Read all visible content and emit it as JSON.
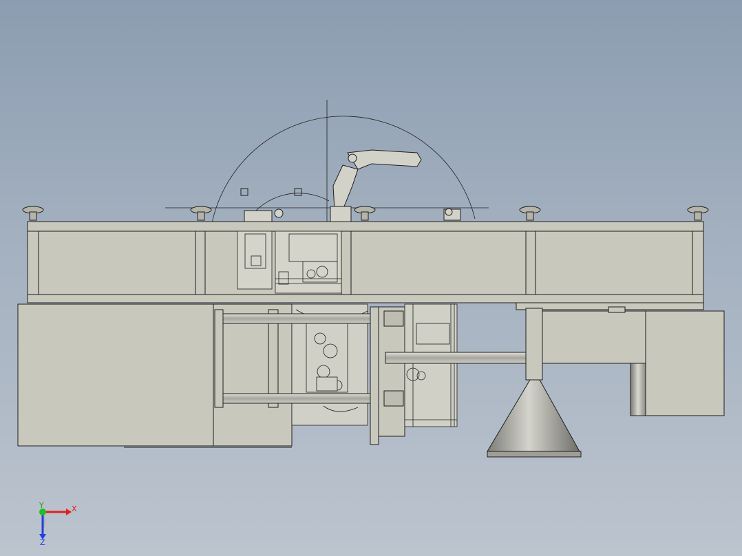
{
  "viewport": {
    "background_top": "#8c9db1",
    "background_bottom": "#bcc4ce"
  },
  "model": {
    "body_fill": "#c8c8bc",
    "line_color": "#2a2a2a",
    "cone_color": "#8f8f88"
  },
  "triad": {
    "x_label": "X",
    "y_label": "Y",
    "z_label": "Z",
    "x_color": "#e02020",
    "y_color": "#20c020",
    "z_color": "#2040e0"
  }
}
